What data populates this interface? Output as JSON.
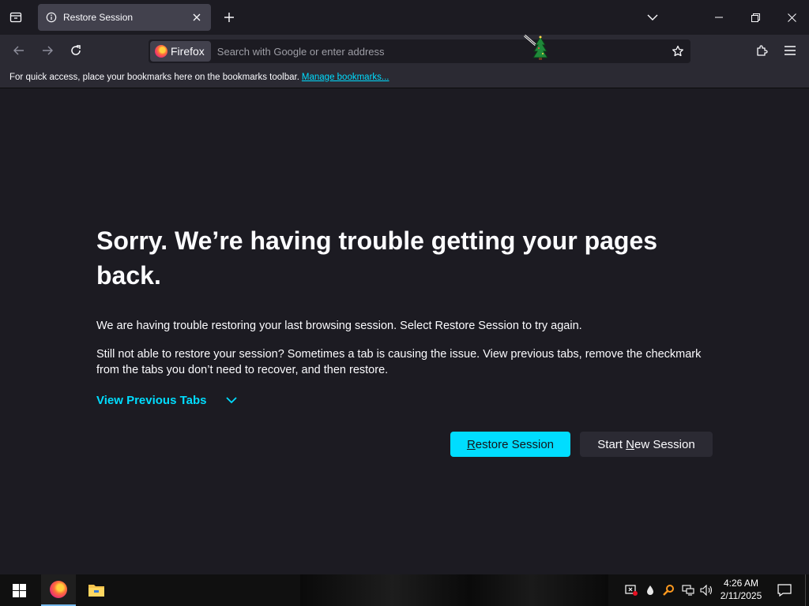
{
  "tab": {
    "title": "Restore Session"
  },
  "urlbar": {
    "identity_label": "Firefox",
    "placeholder": "Search with Google or enter address"
  },
  "bookmarks_bar": {
    "message": "For quick access, place your bookmarks here on the bookmarks toolbar.",
    "manage_link": "Manage bookmarks..."
  },
  "content": {
    "heading": "Sorry. We’re having trouble getting your pages back.",
    "paragraph1": "We are having trouble restoring your last browsing session. Select Restore Session to try again.",
    "paragraph2": "Still not able to restore your session? Sometimes a tab is causing the issue. View previous tabs, remove the checkmark from the tabs you don’t need to recover, and then restore.",
    "view_previous_tabs": "View Previous Tabs",
    "restore_button": {
      "prefix": "",
      "accesskey": "R",
      "suffix": "estore Session"
    },
    "new_session_button": {
      "prefix": "Start ",
      "accesskey": "N",
      "suffix": "ew Session"
    }
  },
  "taskbar": {
    "time": "4:26 AM",
    "date": "2/11/2025"
  },
  "icons": [
    "tab-manager-icon",
    "info-icon",
    "close-icon",
    "plus-icon",
    "chevron-down-icon",
    "minimize-icon",
    "restore-icon",
    "window-close-icon",
    "back-arrow-icon",
    "forward-arrow-icon",
    "reload-icon",
    "firefox-logo-icon",
    "star-icon",
    "extensions-icon",
    "hamburger-menu-icon",
    "windows-start-icon",
    "file-explorer-icon",
    "network-icon",
    "volume-icon",
    "notification-icon"
  ],
  "colors": {
    "accent": "#00ddff",
    "background": "#1c1b22",
    "toolbar": "#2b2a33",
    "tab_selected": "#42414d"
  }
}
